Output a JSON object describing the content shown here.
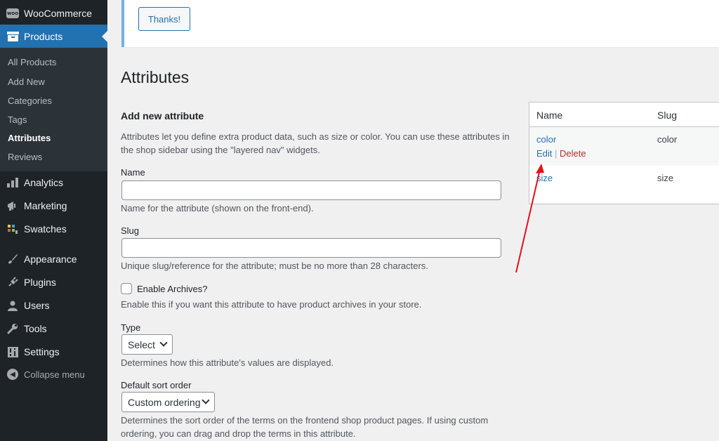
{
  "sidebar": {
    "woocommerce": "WooCommerce",
    "products": "Products",
    "submenu": [
      "All Products",
      "Add New",
      "Categories",
      "Tags",
      "Attributes",
      "Reviews"
    ],
    "analytics": "Analytics",
    "marketing": "Marketing",
    "swatches": "Swatches",
    "appearance": "Appearance",
    "plugins": "Plugins",
    "users": "Users",
    "tools": "Tools",
    "settings": "Settings",
    "collapse": "Collapse menu"
  },
  "notice": {
    "button": "Thanks!"
  },
  "page_title": "Attributes",
  "form": {
    "heading": "Add new attribute",
    "intro": "Attributes let you define extra product data, such as size or color. You can use these attributes in the shop sidebar using the \"layered nav\" widgets.",
    "name_label": "Name",
    "name_value": "",
    "name_help": "Name for the attribute (shown on the front-end).",
    "slug_label": "Slug",
    "slug_value": "",
    "slug_help": "Unique slug/reference for the attribute; must be no more than 28 characters.",
    "archives_label": "Enable Archives?",
    "archives_help": "Enable this if you want this attribute to have product archives in your store.",
    "type_label": "Type",
    "type_value": "Select",
    "type_help": "Determines how this attribute's values are displayed.",
    "sort_label": "Default sort order",
    "sort_value": "Custom ordering",
    "sort_help": "Determines the sort order of the terms on the frontend shop product pages. If using custom ordering, you can drag and drop the terms in this attribute."
  },
  "table": {
    "headers": [
      "Name",
      "Slug"
    ],
    "rows": [
      {
        "name": "color",
        "slug": "color",
        "edit": "Edit",
        "sep": "|",
        "delete": "Delete"
      },
      {
        "name": "size",
        "slug": "size"
      }
    ]
  },
  "colors": {
    "accent": "#2271b1",
    "sidebar": "#1d2327",
    "annotation": "#e0121b"
  }
}
